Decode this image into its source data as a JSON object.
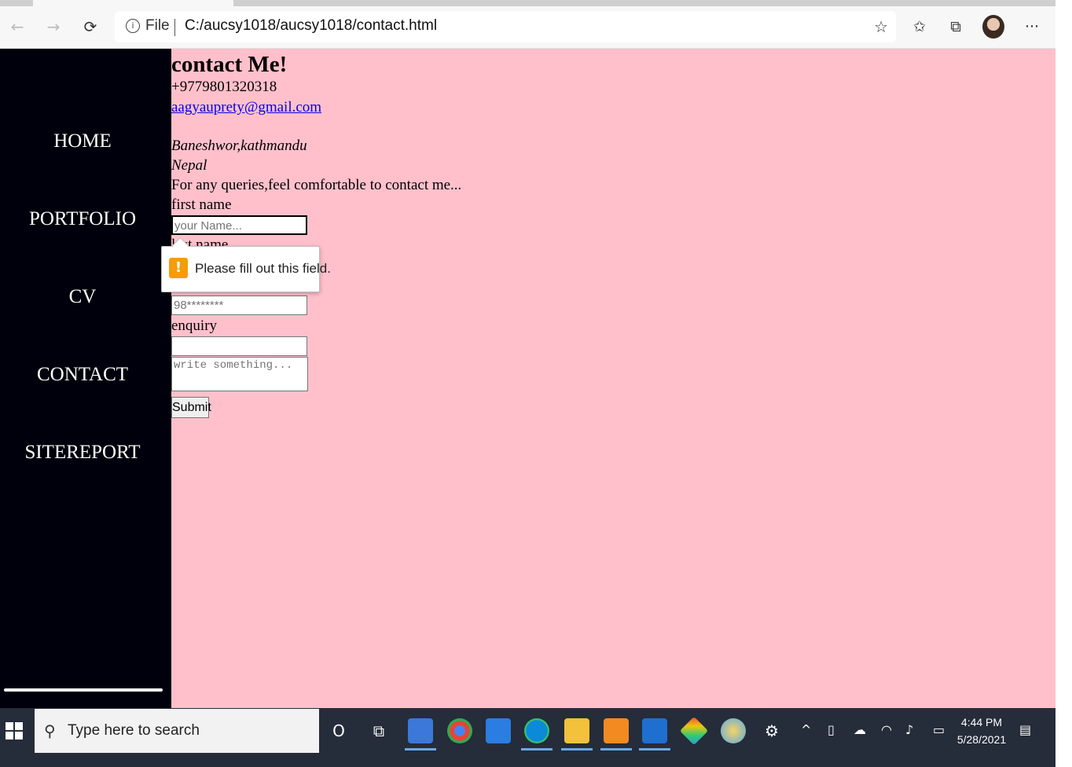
{
  "browser": {
    "address_scheme": "File",
    "url": "C:/aucsy1018/aucsy1018/contact.html",
    "back_icon": "←",
    "forward_icon": "→",
    "refresh_icon": "⟳",
    "info_icon": "i",
    "favorite_add_icon": "☆",
    "favorites_icon": "✩",
    "collections_icon": "⧉",
    "more_icon": "···"
  },
  "sidebar": {
    "items": [
      {
        "label": "HOME"
      },
      {
        "label": "PORTFOLIO"
      },
      {
        "label": "CV"
      },
      {
        "label": "CONTACT"
      },
      {
        "label": "SITEREPORT"
      }
    ]
  },
  "contact": {
    "heading": "contact Me!",
    "phone": "+9779801320318",
    "email": "aagyauprety@gmail.com",
    "address_line1": "Baneshwor,kathmandu",
    "address_line2": "Nepal",
    "note": "For any queries,feel comfortable to contact me...",
    "first_name_label": "first name",
    "first_name_placeholder": "your Name...",
    "last_name_label_partial": "last name",
    "phone_placeholder": "98********",
    "enquiry_label": "enquiry",
    "message_placeholder": "write something...",
    "submit_label": "Submit"
  },
  "tooltip": {
    "icon": "!",
    "message": "Please fill out this field."
  },
  "taskbar": {
    "search_placeholder": "Type here to search",
    "search_icon": "⚲",
    "cortana_icon": "O",
    "task_view_icon": "⧉",
    "time": "4:44 PM",
    "date": "5/28/2021",
    "notification_icon": "▤"
  },
  "colors": {
    "page_background": "#ffc0cb",
    "sidebar_background": "#00000c",
    "link": "#0000ee",
    "warning": "#f59c0a",
    "taskbar": "#252c3a"
  }
}
